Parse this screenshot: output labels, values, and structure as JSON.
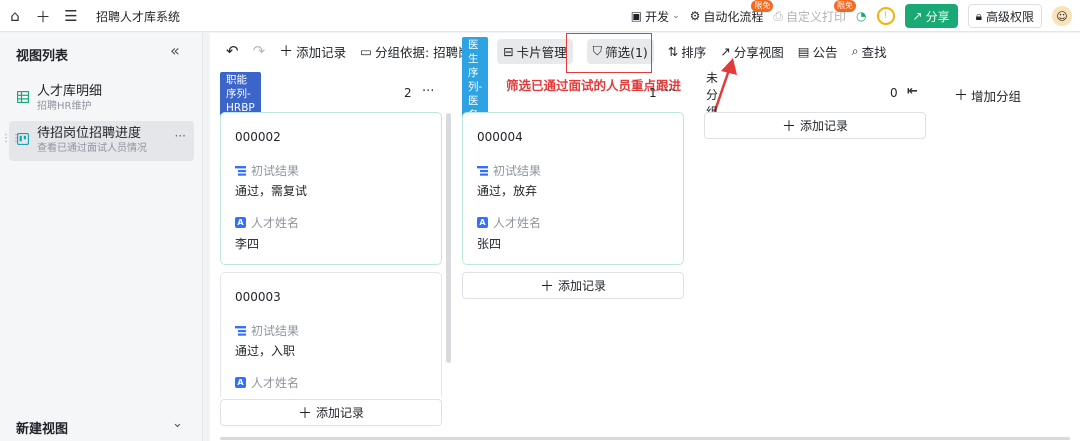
{
  "topbar": {
    "title": "招聘人才库系统",
    "dev_label": "开发",
    "automation_label": "自动化流程",
    "automation_badge": "限免",
    "print_label": "自定义打印",
    "print_badge": "限免",
    "share_label": "分享",
    "perm_label": "高级权限"
  },
  "sidebar": {
    "header": "视图列表",
    "items": [
      {
        "name": "人才库明细",
        "desc": "招聘HR维护"
      },
      {
        "name": "待招岗位招聘进度",
        "desc": "查看已通过面试人员情况"
      }
    ],
    "new_view": "新建视图"
  },
  "toolbar": {
    "add_record": "添加记录",
    "group_by": "分组依据: 招聘岗位",
    "card_mgmt": "卡片管理",
    "filter": "筛选(1)",
    "sort": "排序",
    "share_view": "分享视图",
    "notice": "公告",
    "search": "查找"
  },
  "annotation": "筛选已通过面试的人员重点跟进",
  "columns": [
    {
      "tag": "职能序列-HRBP",
      "tag_color": "#3c65c9",
      "count": "2",
      "cards": [
        {
          "id": "000002",
          "field1_label": "初试结果",
          "field1_value": "通过，需复试",
          "field2_label": "人才姓名",
          "field2_value": "李四"
        },
        {
          "id": "000003",
          "field1_label": "初试结果",
          "field1_value": "通过，入职",
          "field2_label": "人才姓名"
        }
      ],
      "add_label": "添加记录"
    },
    {
      "tag": "医生序列-医务主任",
      "tag_color": "#2ea3e3",
      "count": "1",
      "cards": [
        {
          "id": "000004",
          "field1_label": "初试结果",
          "field1_value": "通过，放弃",
          "field2_label": "人才姓名",
          "field2_value": "张四"
        }
      ],
      "add_label": "添加记录"
    },
    {
      "tag": "未分组",
      "count": "0",
      "add_label": "添加记录"
    }
  ],
  "add_group": "增加分组",
  "colors": {
    "accent_green": "#19a974",
    "highlight_red": "#e23b3b",
    "badge_orange": "#f26a21"
  }
}
